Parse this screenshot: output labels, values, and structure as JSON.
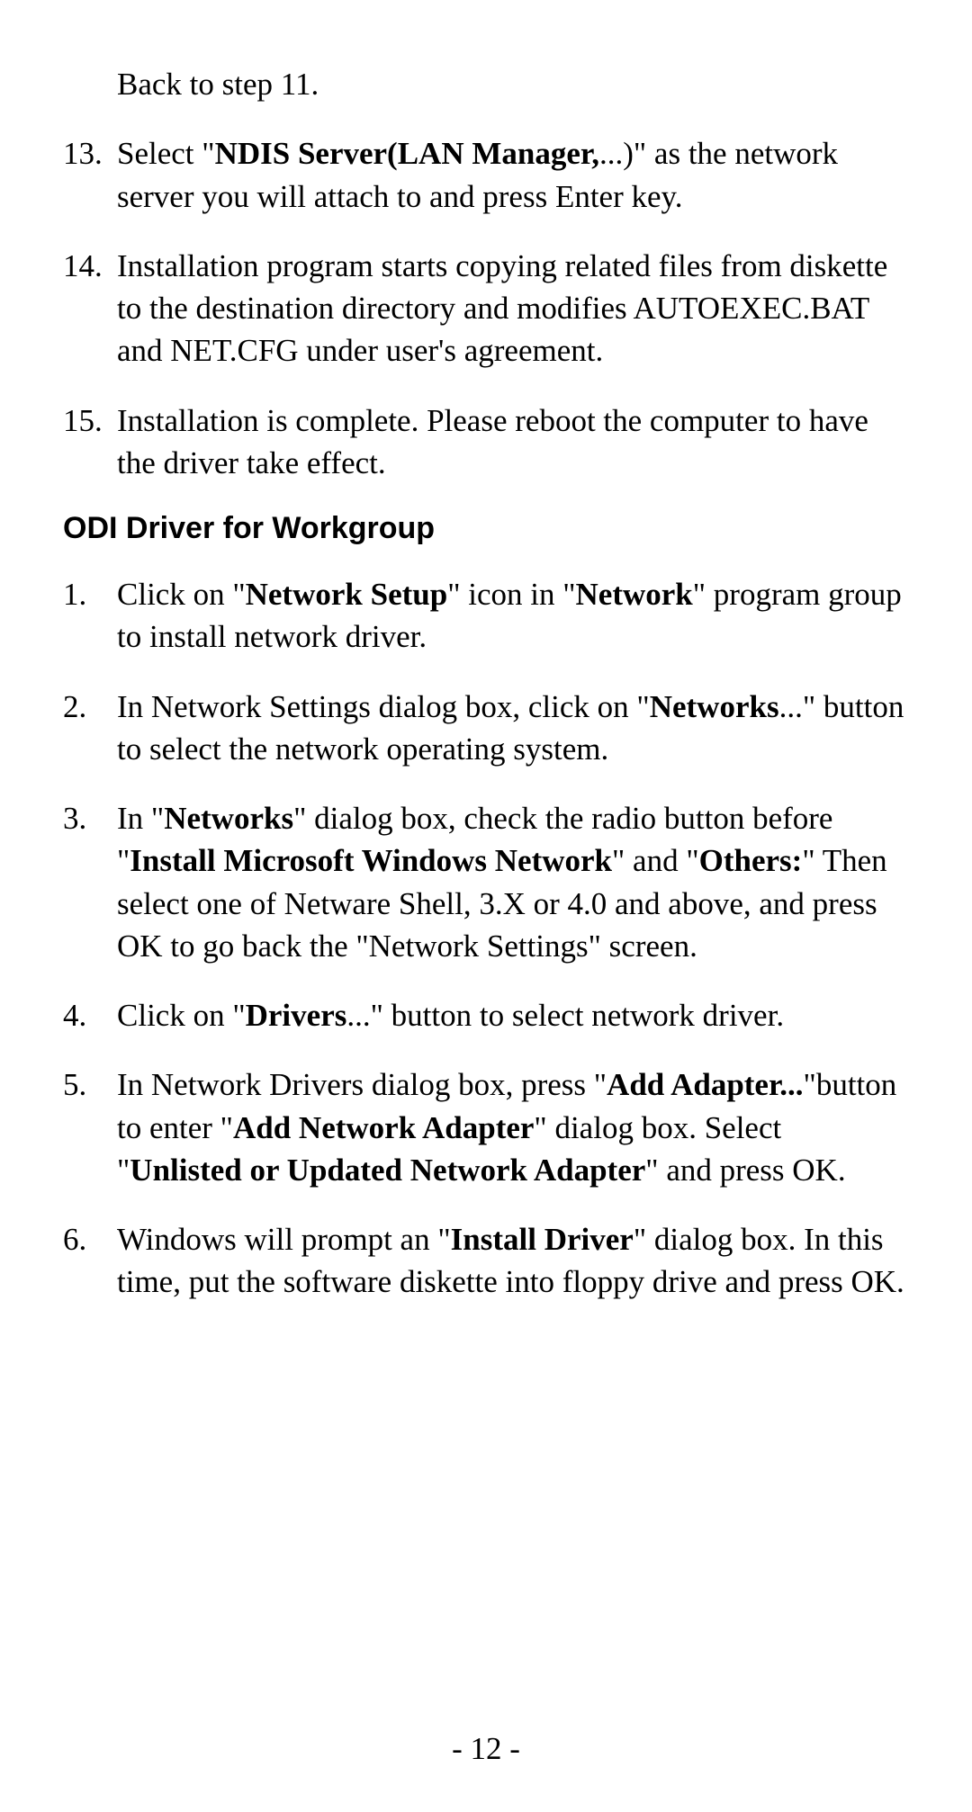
{
  "continuation_text": "Back to step 11.",
  "list_a": [
    {
      "num": "13.",
      "segments": [
        {
          "t": "Select \"",
          "b": false
        },
        {
          "t": "NDIS Server(LAN Manager,",
          "b": true
        },
        {
          "t": "...)\" as the network server you will attach to and press Enter key.",
          "b": false
        }
      ]
    },
    {
      "num": "14.",
      "segments": [
        {
          "t": "Installation program starts copying related files from diskette to the destination directory and modifies AUTOEXEC.BAT and NET.CFG under user's agreement.",
          "b": false
        }
      ]
    },
    {
      "num": "15.",
      "segments": [
        {
          "t": "Installation is complete.  Please reboot the computer to have the driver take effect.",
          "b": false
        }
      ]
    }
  ],
  "heading": "ODI Driver for Workgroup",
  "list_b": [
    {
      "num": "1.",
      "segments": [
        {
          "t": "Click on \"",
          "b": false
        },
        {
          "t": "Network Setup",
          "b": true
        },
        {
          "t": "\" icon in \"",
          "b": false
        },
        {
          "t": "Network",
          "b": true
        },
        {
          "t": "\" program group to install network driver.",
          "b": false
        }
      ]
    },
    {
      "num": "2.",
      "segments": [
        {
          "t": "In Network Settings dialog box, click on \"",
          "b": false
        },
        {
          "t": "Networks",
          "b": true
        },
        {
          "t": "...\" button to select the network operating system.",
          "b": false
        }
      ]
    },
    {
      "num": "3.",
      "segments": [
        {
          "t": "In \"",
          "b": false
        },
        {
          "t": "Networks",
          "b": true
        },
        {
          "t": "\" dialog box, check the radio button before \"",
          "b": false
        },
        {
          "t": "Install Microsoft Windows Network",
          "b": true
        },
        {
          "t": "\" and \"",
          "b": false
        },
        {
          "t": "Others:",
          "b": true
        },
        {
          "t": "\" Then select one of Netware Shell, 3.X or 4.0 and above, and press OK to go back the \"Network Settings\" screen.",
          "b": false
        }
      ]
    },
    {
      "num": "4.",
      "segments": [
        {
          "t": "Click on \"",
          "b": false
        },
        {
          "t": "Drivers",
          "b": true
        },
        {
          "t": "...\" button to select network driver.",
          "b": false
        }
      ]
    },
    {
      "num": "5.",
      "segments": [
        {
          "t": "In Network Drivers dialog box, press \"",
          "b": false
        },
        {
          "t": "Add Adapter...",
          "b": true
        },
        {
          "t": "\"button to enter \"",
          "b": false
        },
        {
          "t": "Add Network Adapter",
          "b": true
        },
        {
          "t": "\" dialog box. Select \"",
          "b": false
        },
        {
          "t": "Unlisted or Updated Network Adapter",
          "b": true
        },
        {
          "t": "\" and press OK.",
          "b": false
        }
      ]
    },
    {
      "num": "6.",
      "segments": [
        {
          "t": "Windows will prompt an \"",
          "b": false
        },
        {
          "t": "Install Driver",
          "b": true
        },
        {
          "t": "\" dialog box. In this time, put the software diskette into floppy drive and press OK.",
          "b": false
        }
      ]
    }
  ],
  "page_number_prefix": "- ",
  "page_number": "12",
  "page_number_suffix": " -"
}
